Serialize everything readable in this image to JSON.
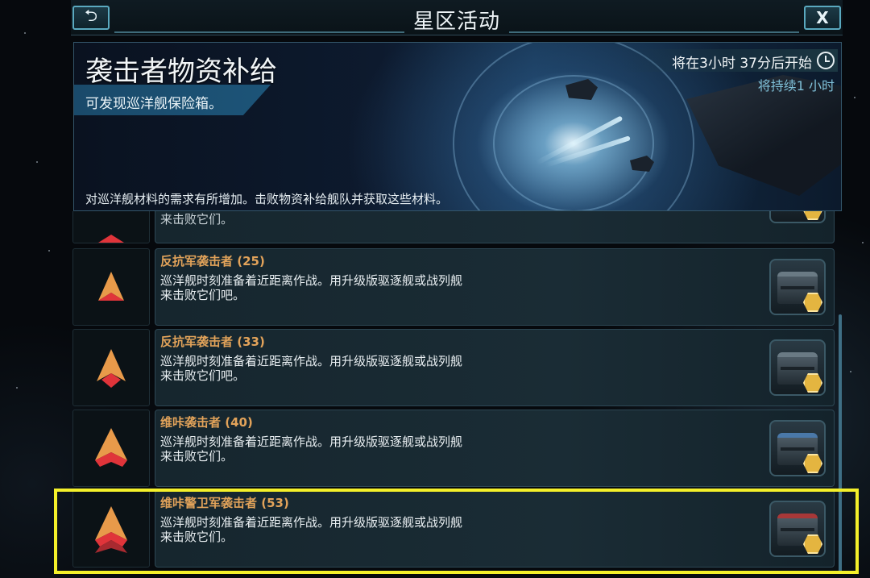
{
  "header": {
    "title": "星区活动",
    "back_label": "⮌",
    "close_label": "X"
  },
  "event": {
    "title": "袭击者物资补给",
    "subtitle": "可发现巡洋舰保险箱。",
    "countdown": "将在3小时 37分后开始",
    "duration": "将持续1 小时",
    "description": "对巡洋舰材料的需求有所增加。击败物资补给舰队并获取这些材料。"
  },
  "partial_row": {
    "desc_tail": "来击败它们。"
  },
  "targets": [
    {
      "name": "反抗军袭击者 (25)",
      "desc_line1": "巡洋舰时刻准备着近距离作战。用升级版驱逐舰或战列舰",
      "desc_line2": "来击败它们吧。",
      "icon": "rank-chevron-1-icon",
      "chest": "gray"
    },
    {
      "name": "反抗军袭击者 (33)",
      "desc_line1": "巡洋舰时刻准备着近距离作战。用升级版驱逐舰或战列舰",
      "desc_line2": "来击败它们吧。",
      "icon": "rank-chevron-2-icon",
      "chest": "gray"
    },
    {
      "name": "维咔袭击者 (40)",
      "desc_line1": "巡洋舰时刻准备着近距离作战。用升级版驱逐舰或战列舰",
      "desc_line2": "来击败它们。",
      "icon": "rank-chevron-3-icon",
      "chest": "blue"
    },
    {
      "name": "维咔警卫军袭击者 (53)",
      "desc_line1": "巡洋舰时刻准备着近距离作战。用升级版驱逐舰或战列舰",
      "desc_line2": "来击败它们。",
      "icon": "rank-chevron-4-icon",
      "chest": "red"
    }
  ],
  "colors": {
    "accent_orange": "#e2a35a",
    "highlight_yellow": "#f4f02a",
    "rank_orange": "#e89a4a",
    "rank_red": "#e0343a"
  }
}
